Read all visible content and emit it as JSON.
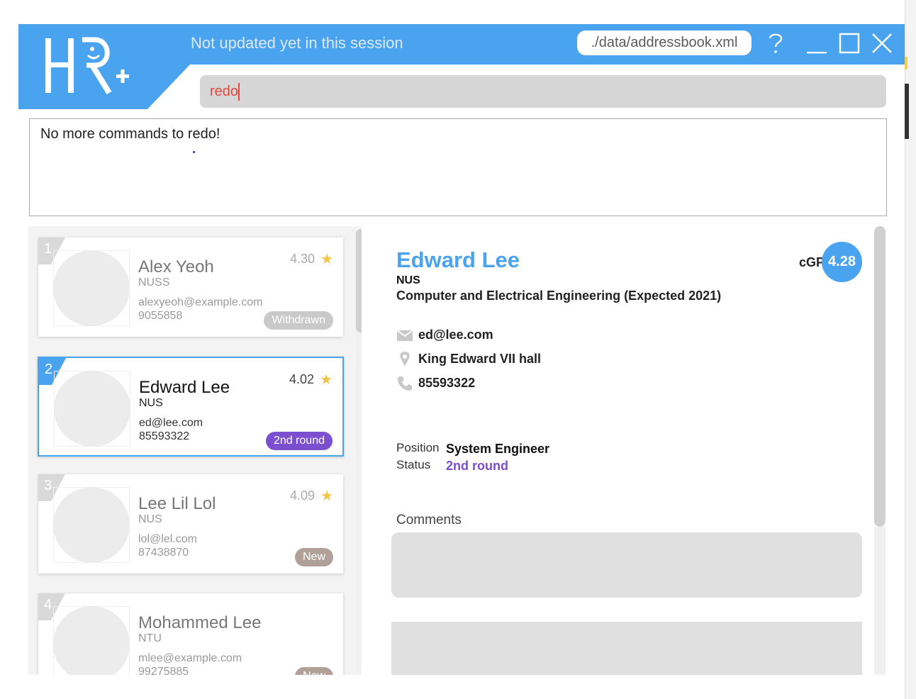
{
  "header": {
    "logo_text": "HR+",
    "session_status": "Not updated yet in this session",
    "file_path": "./data/addressbook.xml",
    "help_label": "?",
    "minimize_label": "_",
    "maximize_label": "□",
    "close_label": "✕"
  },
  "command": {
    "value": "redo"
  },
  "result": {
    "message": "No more commands to redo!"
  },
  "candidates": [
    {
      "index": "1",
      "name": "Alex Yeoh",
      "school": "NUSS",
      "email": "alexyeoh@example.com",
      "phone": "9055858",
      "gpa": "4.30",
      "status": "Withdrawn",
      "status_color": "#c9c9c9"
    },
    {
      "index": "2",
      "name": "Edward Lee",
      "school": "NUS",
      "email": "ed@lee.com",
      "phone": "85593322",
      "gpa": "4.02",
      "status": "2nd round",
      "status_color": "#7b4fcf",
      "selected": true
    },
    {
      "index": "3",
      "name": "Lee Lil Lol",
      "school": "NUS",
      "email": "lol@lel.com",
      "phone": "87438870",
      "gpa": "4.09",
      "status": "New",
      "status_color": "#b0a097"
    },
    {
      "index": "4",
      "name": "Mohammed Lee",
      "school": "NTU",
      "email": "mlee@example.com",
      "phone": "99275885",
      "gpa": "",
      "status": "New",
      "status_color": "#b0a097"
    }
  ],
  "detail": {
    "name": "Edward Lee",
    "school": "NUS",
    "major": "Computer and Electrical Engineering (Expected 2021)",
    "cgpa_label": "cGPA",
    "cgpa": "4.28",
    "email": "ed@lee.com",
    "address": "King Edward VII hall",
    "phone": "85593322",
    "position_label": "Position",
    "position": "System Engineer",
    "status_label": "Status",
    "status": "2nd round",
    "comments_label": "Comments"
  },
  "colors": {
    "accent": "#4aa3ef",
    "command_text": "#e2483c",
    "status_purple": "#7b4fcf"
  },
  "icons": [
    "mail-icon",
    "location-pin-icon",
    "phone-icon",
    "star-icon",
    "help-icon",
    "minimize-icon",
    "maximize-icon",
    "close-icon"
  ]
}
